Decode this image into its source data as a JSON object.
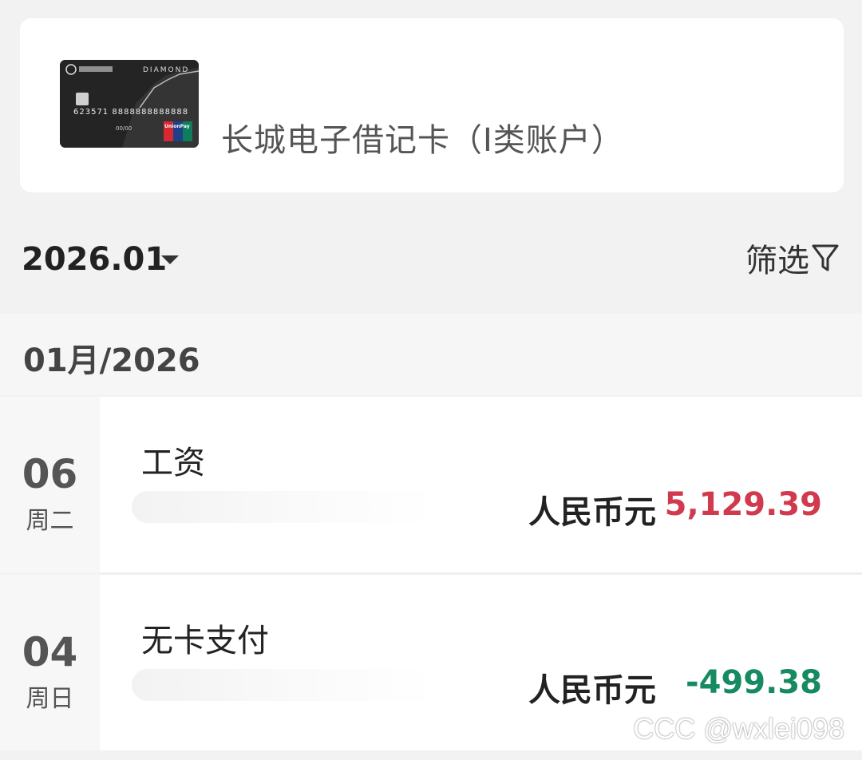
{
  "account": {
    "card_name": "长城电子借记卡（I类账户）",
    "card_image": {
      "brand_text": "DIAMOND",
      "number_text": "623571 8888888888888",
      "expiry_text": "00/00",
      "network_text": "UnionPay"
    }
  },
  "filter": {
    "month": "2026.01",
    "label": "筛选"
  },
  "group": {
    "title": "01月/2026"
  },
  "transactions": [
    {
      "day": "06",
      "weekday": "周二",
      "title": "工资",
      "currency": "人民币元",
      "amount": "5,129.39",
      "amount_color": "#d03a4c"
    },
    {
      "day": "04",
      "weekday": "周日",
      "title": "无卡支付",
      "currency": "人民币元",
      "amount": "-499.38",
      "amount_color": "#178a61"
    }
  ],
  "watermark": "CCC @wxlei098"
}
